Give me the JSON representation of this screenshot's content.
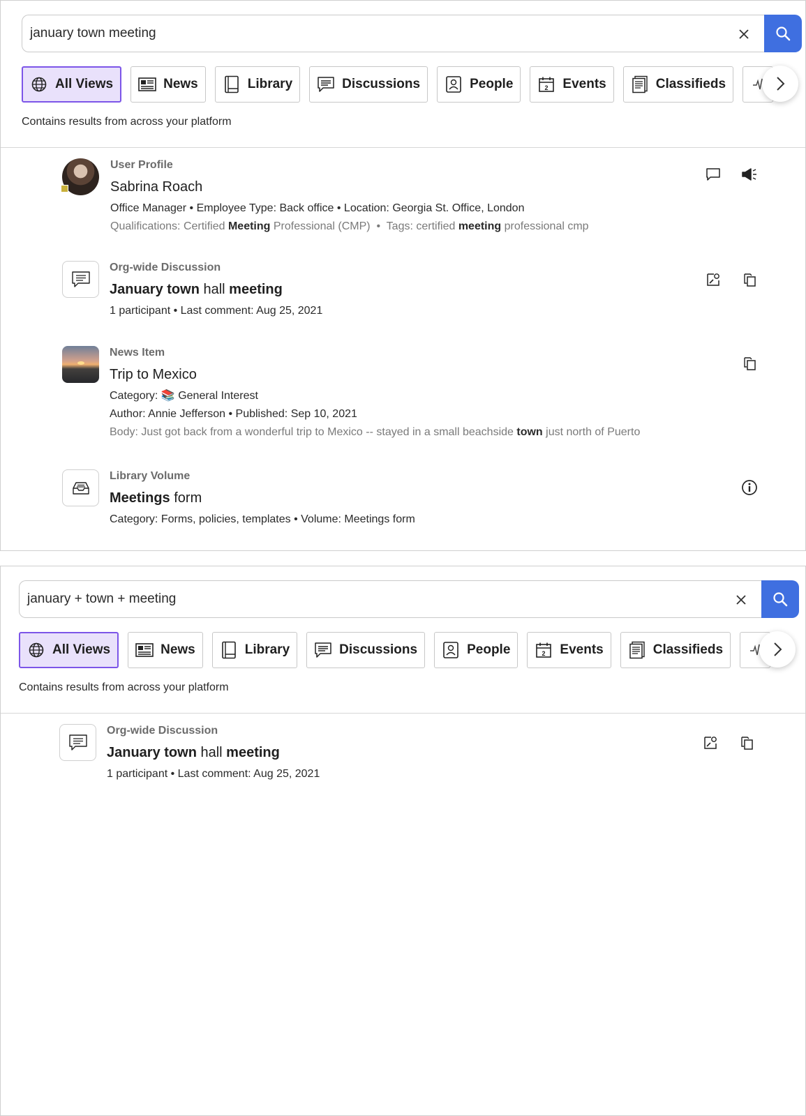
{
  "brand": {
    "accent": "#3f6fe0",
    "active_chip_bg": "#e9e1fb",
    "active_chip_border": "#7c55e8"
  },
  "panel1": {
    "search": {
      "value": "january town meeting"
    },
    "filters": [
      {
        "label": "All Views",
        "icon": "globe-icon",
        "active": true
      },
      {
        "label": "News",
        "icon": "newspaper-icon"
      },
      {
        "label": "Library",
        "icon": "book-icon"
      },
      {
        "label": "Discussions",
        "icon": "chat-lines-icon"
      },
      {
        "label": "People",
        "icon": "id-badge-icon"
      },
      {
        "label": "Events",
        "icon": "calendar-icon"
      },
      {
        "label": "Classifieds",
        "icon": "document-list-icon"
      },
      {
        "label": "",
        "icon": "activity-icon"
      }
    ],
    "scope_note": "Contains results from across your platform",
    "results": [
      {
        "kind": "User Profile",
        "title": "Sabrina Roach",
        "line1": "Office Manager • Employee Type: Back office • Location: Georgia St. Office, London",
        "line2_parts": [
          "Qualifications: Certified ",
          "Meeting",
          " Professional (CMP)",
          "  •  Tags: certified ",
          "meeting",
          " professional cmp"
        ],
        "actions": [
          "message-icon",
          "megaphone-icon"
        ]
      },
      {
        "kind": "Org-wide Discussion",
        "title_parts": [
          "January town",
          " hall ",
          "meeting"
        ],
        "line1": "1 participant • Last comment: Aug 25, 2021",
        "actions": [
          "edit-note-icon",
          "copy-icon"
        ]
      },
      {
        "kind": "News Item",
        "title": "Trip to Mexico",
        "line1_prefix": "Category:",
        "line1_emoji": "📚",
        "line1_suffix": "General Interest",
        "line2": "Author: Annie Jefferson • Published: Sep 10, 2021",
        "line3_parts": [
          "Body: Just got back from a wonderful trip to Mexico -- stayed in a small beachside ",
          "town",
          " just north of Puerto"
        ],
        "actions": [
          "copy-icon"
        ]
      },
      {
        "kind": "Library Volume",
        "title_parts": [
          "Meetings",
          " form"
        ],
        "line1": "Category: Forms, policies, templates • Volume: Meetings form",
        "actions": [
          "info-icon"
        ]
      }
    ]
  },
  "panel2": {
    "search": {
      "value": "january + town + meeting"
    },
    "scope_note": "Contains results from across your platform",
    "results": [
      {
        "kind": "Org-wide Discussion",
        "title_parts": [
          "January town",
          " hall ",
          "meeting"
        ],
        "line1": "1 participant • Last comment: Aug 25, 2021",
        "actions": [
          "edit-note-icon",
          "copy-icon"
        ]
      }
    ]
  }
}
